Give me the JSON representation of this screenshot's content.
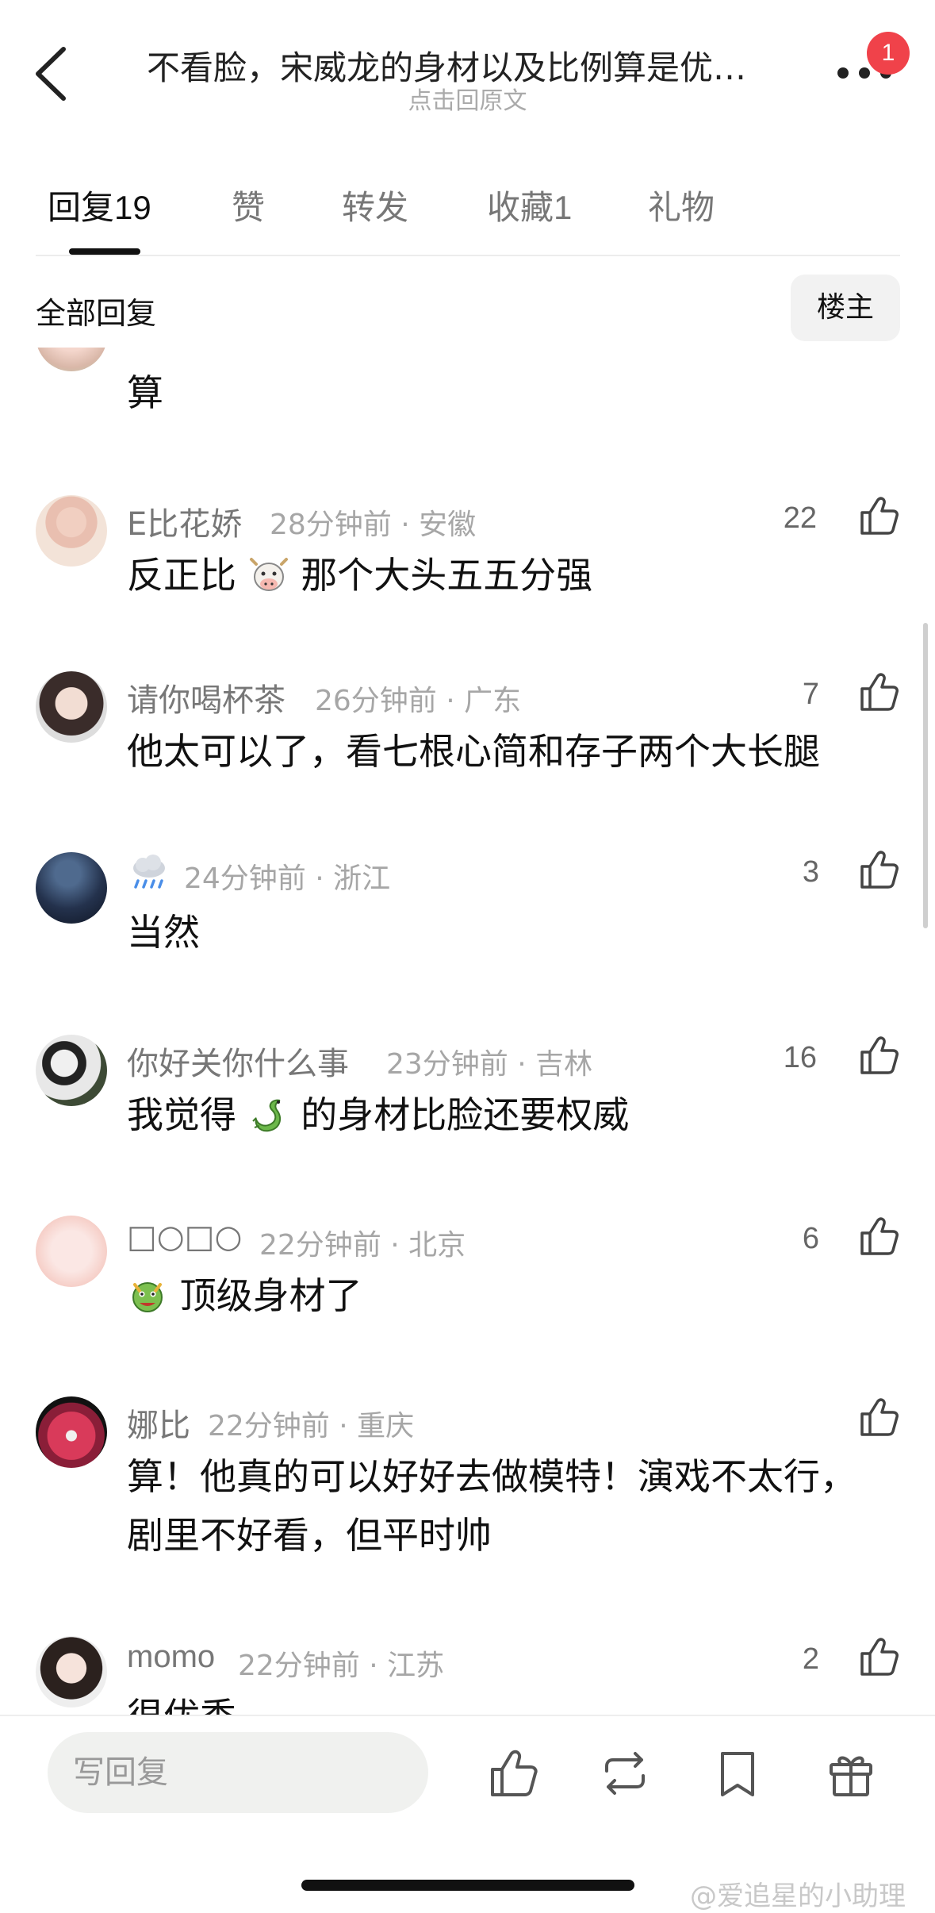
{
  "header": {
    "title": "不看脸，宋威龙的身材以及比例算是优…",
    "subtitle": "点击回原文",
    "notification_count": "1"
  },
  "tabs": [
    {
      "label": "回复",
      "count": "19",
      "active": true
    },
    {
      "label": "赞",
      "count": "",
      "active": false
    },
    {
      "label": "转发",
      "count": "",
      "active": false
    },
    {
      "label": "收藏",
      "count": "1",
      "active": false
    },
    {
      "label": "礼物",
      "count": "",
      "active": false
    }
  ],
  "filter": {
    "all_replies_label": "全部回复",
    "op_only_label": "楼主"
  },
  "comments": [
    {
      "username": "",
      "meta": "",
      "likes": "",
      "text": "算"
    },
    {
      "username": "E比花娇",
      "meta": "28分钟前 · 安徽",
      "likes": "22",
      "text_before": "反正比",
      "emoji": "cow-face",
      "text_after": "那个大头五五分强"
    },
    {
      "username": "请你喝杯茶",
      "meta": "26分钟前 · 广东",
      "likes": "7",
      "text": "他太可以了，看七根心简和存子两个大长腿"
    },
    {
      "username": "",
      "username_emoji": "rain-cloud",
      "meta": "24分钟前 · 浙江",
      "likes": "3",
      "text": "当然"
    },
    {
      "username": "你好关你什么事",
      "meta": "23分钟前 · 吉林",
      "likes": "16",
      "text_before": "我觉得",
      "emoji": "dragon",
      "text_after": "的身材比脸还要权威"
    },
    {
      "username": "□○□○",
      "meta": "22分钟前 · 北京",
      "likes": "6",
      "emoji": "dragon-face",
      "text_after": "顶级身材了"
    },
    {
      "username": "娜比",
      "meta": "22分钟前 · 重庆",
      "likes": "",
      "text_line1": "算！他真的可以好好去做模特！演戏不太行，",
      "text_line2": "剧里不好看，但平时帅"
    },
    {
      "username": "momo",
      "meta": "22分钟前 · 江苏",
      "likes": "2",
      "text": "很优秀"
    }
  ],
  "bottom_bar": {
    "reply_placeholder": "写回复",
    "icons": [
      "like-icon",
      "repost-icon",
      "bookmark-icon",
      "gift-icon"
    ]
  },
  "watermark": "@爱追星的小助理",
  "colors": {
    "badge": "#f0424a",
    "secondary_text": "#777777",
    "meta_text": "#a6a6a6"
  }
}
